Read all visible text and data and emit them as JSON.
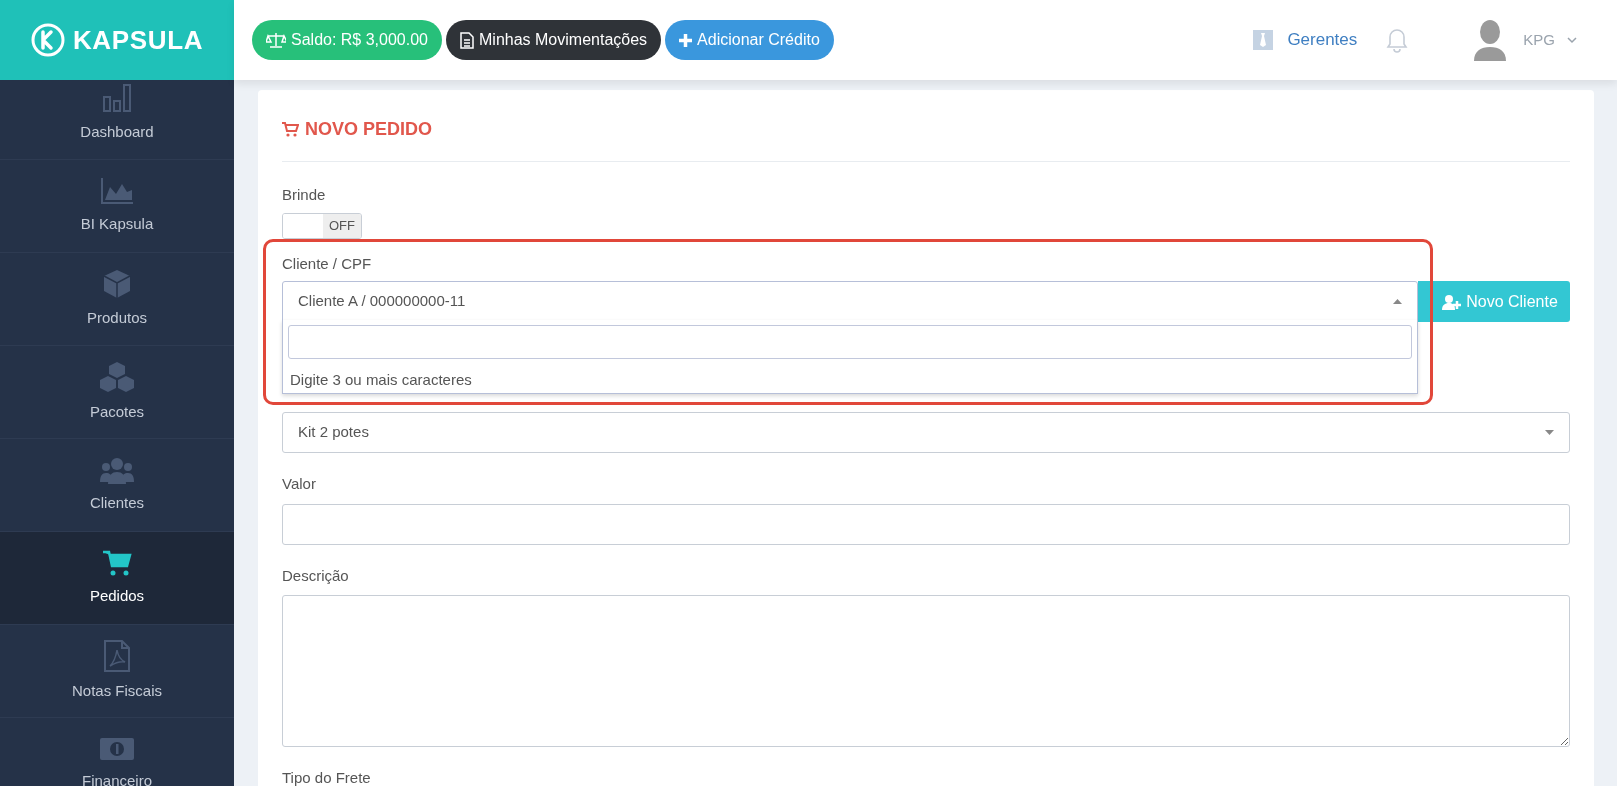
{
  "brand": {
    "name": "KAPSULA"
  },
  "header": {
    "buttons": [
      {
        "kind": "balance",
        "label": "Saldo: R$ 3,000.00"
      },
      {
        "kind": "statement",
        "label": "Minhas Movimentações"
      },
      {
        "kind": "credit",
        "label": "Adicionar Crédito"
      }
    ],
    "managers_link": "Gerentes",
    "user": "KPG"
  },
  "sidebar": {
    "items": [
      {
        "kind": "bars",
        "label": "Dashboard",
        "selected": false
      },
      {
        "kind": "area",
        "label": "BI Kapsula",
        "selected": false
      },
      {
        "kind": "cube",
        "label": "Produtos",
        "selected": false
      },
      {
        "kind": "cubes",
        "label": "Pacotes",
        "selected": false
      },
      {
        "kind": "users",
        "label": "Clientes",
        "selected": false
      },
      {
        "kind": "cart",
        "label": "Pedidos",
        "selected": true
      },
      {
        "kind": "pdf",
        "label": "Notas Fiscais",
        "selected": false
      },
      {
        "kind": "money",
        "label": "Financeiro",
        "selected": false
      }
    ]
  },
  "form": {
    "title": "NOVO PEDIDO",
    "gift": {
      "label": "Brinde",
      "on": false,
      "state_label": "OFF"
    },
    "client": {
      "label": "Cliente / CPF",
      "value": "Cliente A / 000000000-11",
      "expanded": true,
      "hint": "Digite 3 ou mais caracteres",
      "new_button": "Novo Cliente"
    },
    "product": {
      "value": "Kit 2 potes"
    },
    "amount": {
      "label": "Valor"
    },
    "description": {
      "label": "Descrição"
    },
    "shipping": {
      "label": "Tipo do Frete"
    }
  }
}
